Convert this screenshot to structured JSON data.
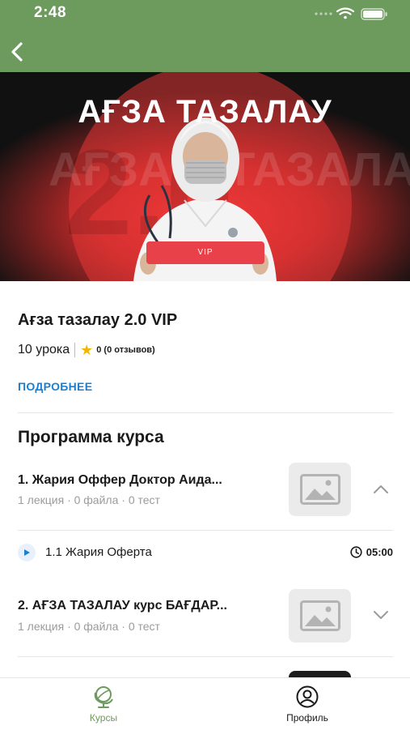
{
  "status_bar": {
    "time": "2:48"
  },
  "colors": {
    "header_bg": "#6d9a5d",
    "accent_link": "#1a7fd1",
    "tab_active": "#6d9a5d",
    "banner_red": "#e8414a"
  },
  "banner": {
    "title": "АҒЗА ТАЗАЛАУ",
    "plate_text": "VIP"
  },
  "course": {
    "title": "Ағза тазалау 2.0 VIP",
    "lessons_count": "10 урока",
    "rating": "0 (0 отзывов)",
    "more_link": "ПОДРОБНЕЕ"
  },
  "program": {
    "title": "Программа курса",
    "modules": [
      {
        "title": "1. Жария Оффер Доктор Аида...",
        "meta": "1 лекция · 0 файла · 0 тест",
        "expanded": true,
        "lessons": [
          {
            "title": "1.1 Жария Оферта",
            "duration": "05:00"
          }
        ]
      },
      {
        "title": "2. АҒЗА ТАЗАЛАУ курс БАҒДАР...",
        "meta": "1 лекция · 0 файла · 0 тест",
        "expanded": false
      }
    ]
  },
  "tabbar": {
    "courses_label": "Курсы",
    "profile_label": "Профиль",
    "active": "courses"
  },
  "icons": [
    "back-arrow-icon",
    "wifi-icon",
    "battery-icon",
    "star-icon",
    "image-placeholder-icon",
    "chevron-up-icon",
    "chevron-down-icon",
    "play-icon",
    "clock-icon",
    "globe-icon",
    "profile-icon"
  ]
}
